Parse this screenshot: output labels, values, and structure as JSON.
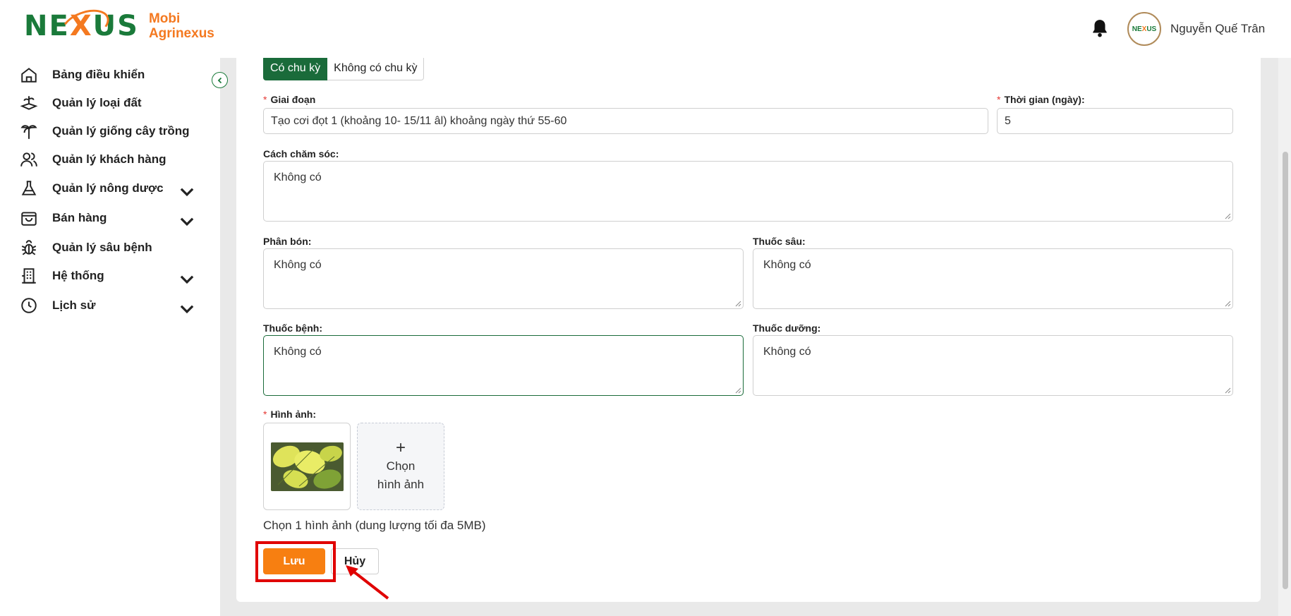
{
  "brand": {
    "line1": "Mobi",
    "line2": "Agrinexus",
    "mark_left": "NE",
    "mark_x": "X",
    "mark_right": "US"
  },
  "user": {
    "name": "Nguyễn Quế Trân"
  },
  "sidebar": {
    "items": [
      {
        "label": "Bảng điều khiển",
        "icon": "home-icon",
        "has_children": false
      },
      {
        "label": "Quản lý loại đất",
        "icon": "soil-icon",
        "has_children": false
      },
      {
        "label": "Quản lý giống cây trồng",
        "icon": "palm-tree-icon",
        "has_children": false
      },
      {
        "label": "Quản lý khách hàng",
        "icon": "users-icon",
        "has_children": false
      },
      {
        "label": "Quản lý nông dược",
        "icon": "flask-icon",
        "has_children": true
      },
      {
        "label": "Bán hàng",
        "icon": "shopping-bag-icon",
        "has_children": true
      },
      {
        "label": "Quản lý sâu bệnh",
        "icon": "bug-icon",
        "has_children": false
      },
      {
        "label": "Hệ thống",
        "icon": "building-icon",
        "has_children": true
      },
      {
        "label": "Lịch sử",
        "icon": "clock-icon",
        "has_children": true
      }
    ]
  },
  "tabs": [
    {
      "label": "Có chu kỳ",
      "active": true
    },
    {
      "label": "Không có chu kỳ",
      "active": false
    }
  ],
  "form": {
    "stage": {
      "label": "Giai đoạn",
      "required": "*",
      "value": "Tạo cơi đọt 1 (khoảng 10- 15/11 âl) khoảng ngày thứ 55-60"
    },
    "duration": {
      "label": "Thời gian (ngày):",
      "required": "*",
      "value": "5"
    },
    "care": {
      "label": "Cách chăm sóc:",
      "value": "Không có"
    },
    "fertilizer": {
      "label": "Phân bón:",
      "value": "Không có"
    },
    "insecticide": {
      "label": "Thuốc sâu:",
      "value": "Không có"
    },
    "disease_medicine": {
      "label": "Thuốc bệnh:",
      "value": "Không có"
    },
    "nutrient": {
      "label": "Thuốc dưỡng:",
      "value": "Không có"
    },
    "image": {
      "label": "Hình ảnh:",
      "required": "*",
      "upload_plus": "+",
      "upload_line1": "Chọn",
      "upload_line2": "hình ảnh",
      "hint": "Chọn 1 hình ảnh (dung lượng tối đa 5MB)"
    }
  },
  "actions": {
    "save_label": "Lưu",
    "cancel_label": "Hủy"
  },
  "colors": {
    "brand_green": "#1a6b3a",
    "brand_orange": "#f77f11",
    "annotation_red": "#e00000"
  }
}
